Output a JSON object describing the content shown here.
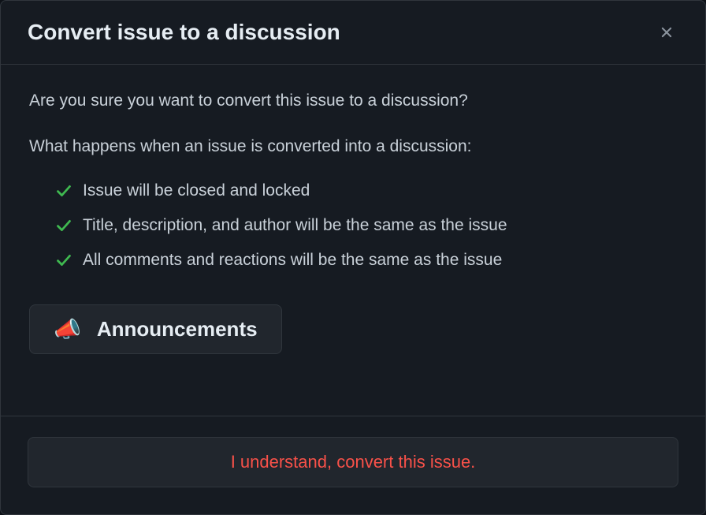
{
  "modal": {
    "title": "Convert issue to a discussion",
    "question": "Are you sure you want to convert this issue to a discussion?",
    "subtitle": "What happens when an issue is converted into a discussion:",
    "checklist": [
      "Issue will be closed and locked",
      "Title, description, and author will be the same as the issue",
      "All comments and reactions will be the same as the issue"
    ],
    "category": {
      "emoji": "📣",
      "label": "Announcements"
    },
    "confirm_label": "I understand, convert this issue."
  }
}
